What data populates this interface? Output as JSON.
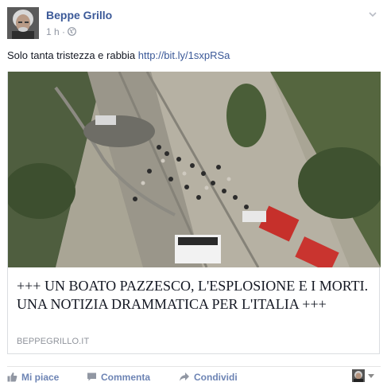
{
  "post": {
    "author": "Beppe Grillo",
    "time": "1 h",
    "separator": "·",
    "message": "Solo tanta tristezza e rabbia",
    "link_text": "http://bit.ly/1sxpRSa"
  },
  "attachment": {
    "headline": "+++ UN BOATO PAZZESCO, L'ESPLOSIONE E I MORTI. UNA NOTIZIA DRAMMATICA PER L'ITALIA +++",
    "domain": "BEPPEGRILLO.IT"
  },
  "actions": {
    "like": "Mi piace",
    "comment": "Commenta",
    "share": "Condividi"
  },
  "colors": {
    "link_blue": "#3b5998",
    "action_blue": "#6d84b4",
    "meta_gray": "#9197a3"
  },
  "icons": [
    "globe-icon",
    "chevron-down-icon",
    "thumbs-up-icon",
    "comment-icon",
    "share-arrow-icon",
    "caret-down-icon"
  ]
}
